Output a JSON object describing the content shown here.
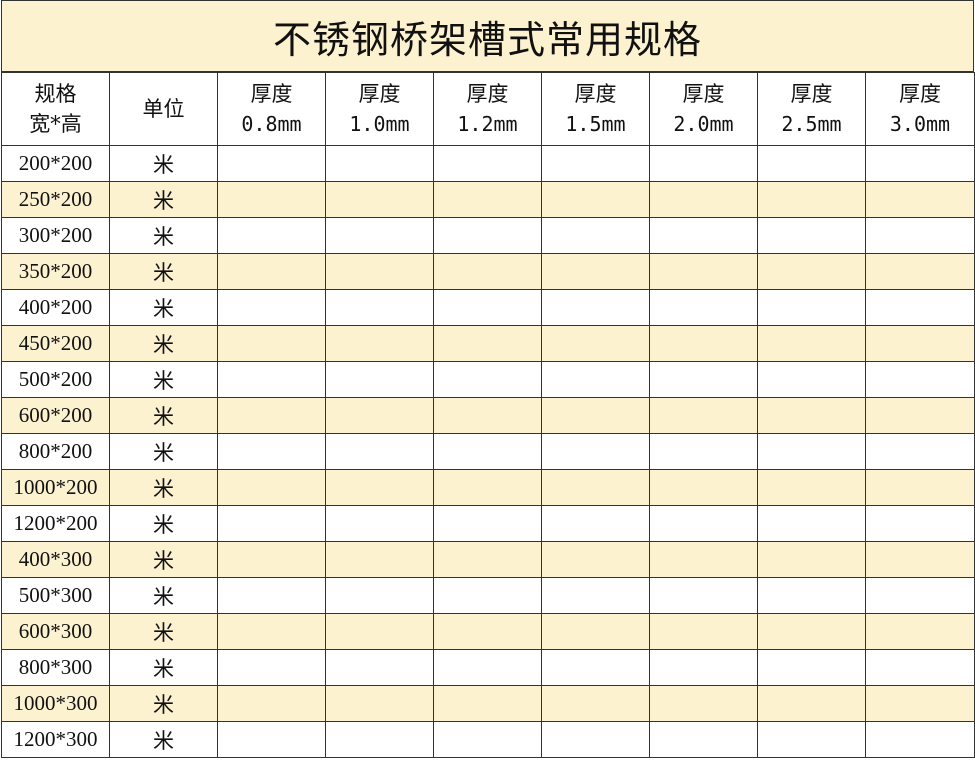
{
  "title": "不锈钢桥架槽式常用规格",
  "header": {
    "spec_line1": "规格",
    "spec_line2": "宽*高",
    "unit": "单位",
    "thickness_label": "厚度",
    "thicknesses": [
      "0.8mm",
      "1.0mm",
      "1.2mm",
      "1.5mm",
      "2.0mm",
      "2.5mm",
      "3.0mm"
    ]
  },
  "rows": [
    {
      "spec": "200*200",
      "unit": "米"
    },
    {
      "spec": "250*200",
      "unit": "米"
    },
    {
      "spec": "300*200",
      "unit": "米"
    },
    {
      "spec": "350*200",
      "unit": "米"
    },
    {
      "spec": "400*200",
      "unit": "米"
    },
    {
      "spec": "450*200",
      "unit": "米"
    },
    {
      "spec": "500*200",
      "unit": "米"
    },
    {
      "spec": "600*200",
      "unit": "米"
    },
    {
      "spec": "800*200",
      "unit": "米"
    },
    {
      "spec": "1000*200",
      "unit": "米"
    },
    {
      "spec": "1200*200",
      "unit": "米"
    },
    {
      "spec": "400*300",
      "unit": "米"
    },
    {
      "spec": "500*300",
      "unit": "米"
    },
    {
      "spec": "600*300",
      "unit": "米"
    },
    {
      "spec": "800*300",
      "unit": "米"
    },
    {
      "spec": "1000*300",
      "unit": "米"
    },
    {
      "spec": "1200*300",
      "unit": "米"
    }
  ],
  "colors": {
    "band": "#fdf2cf",
    "border": "#333333"
  }
}
